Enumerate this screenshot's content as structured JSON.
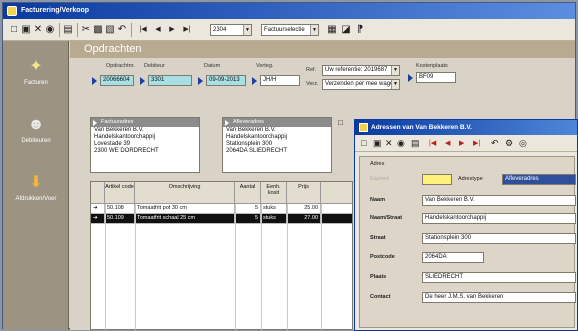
{
  "window": {
    "title": "Facturering/Verkoop"
  },
  "toolbar": {
    "record_value": "2304",
    "filter_value": "Factuurselectie"
  },
  "sidebar": {
    "items": [
      {
        "label": "Facturen"
      },
      {
        "label": "Debiteuren"
      },
      {
        "label": "Afdrukken/Voer"
      }
    ]
  },
  "orders": {
    "heading": "Opdrachten",
    "labels": {
      "order_no": "Opdrachtnr.",
      "debtor": "Debiteur",
      "date": "Datum",
      "rep": "Verteg.",
      "ref": "Ref.",
      "ship": "Verz.",
      "cost_center": "Kostenplaats"
    },
    "values": {
      "order_no": "20066604",
      "debtor": "3301",
      "date": "09-09-2013",
      "rep": "JH/H",
      "ref": "Uw referentie: 2019687",
      "ship": "Verzenden per mee wagen",
      "cost_center": "BF09"
    },
    "invoice_address": {
      "header": "Factuuradres",
      "lines": [
        "Van Bekkeren B.V.",
        "Handelskantoorchappij",
        "Lovestade 39",
        "2300 WE  DORDRECHT"
      ]
    },
    "delivery_address": {
      "header": "Afleveradres",
      "lines": [
        "Van Bekkeren B.V.",
        "Handelskantoorchappij",
        "Stationsplein 300",
        "2064DA  SLIEDRECHT"
      ]
    },
    "grid": {
      "columns": [
        "Artikel code",
        "Omschrijving",
        "Aantal",
        "Eenh. kosit",
        "Prijs"
      ],
      "rows": [
        {
          "marker": "➔",
          "code": "50.108",
          "desc": "Tomaatfrit pot 30 cm",
          "qty": "5",
          "unit": "stuks",
          "price": "25.00",
          "selected": false
        },
        {
          "marker": "➔",
          "code": "50.109",
          "desc": "Tomaatfrit schaal 25 cm",
          "qty": "5",
          "unit": "stuks",
          "price": "27.00",
          "selected": true
        }
      ]
    }
  },
  "dialog": {
    "title": "Adressen van Van Bekkeren B.V.",
    "section": "Adres",
    "labels": {
      "expired": "Expired",
      "address_type": "Adrestype",
      "name": "Naam",
      "name2": "Naam/Straat",
      "street": "Straat",
      "postcode": "Postcode",
      "city": "Plaats",
      "contact": "Contact"
    },
    "values": {
      "address_type": "Afleveradres",
      "name": "Van Bekkeren B.V.",
      "name2": "Handelskantoorchappij",
      "street": "Stationsplein 300",
      "postcode": "2064DA",
      "city": "SLIEDRECHT",
      "contact": "De heer J.M.S. van Bekkeren"
    }
  }
}
